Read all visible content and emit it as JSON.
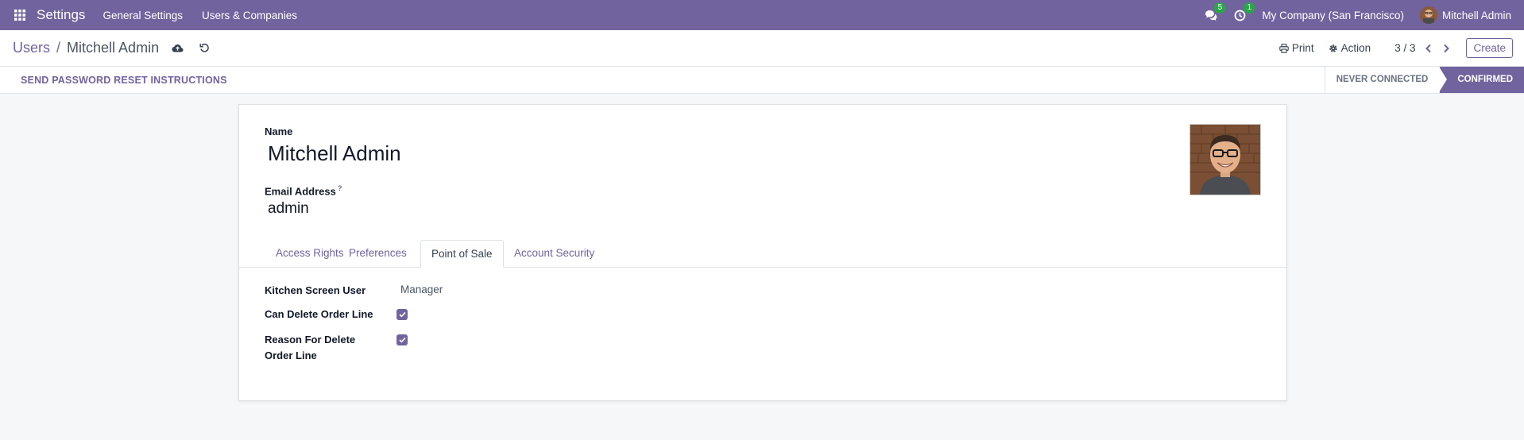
{
  "navbar": {
    "app_title": "Settings",
    "menu": [
      "General Settings",
      "Users & Companies"
    ],
    "messages_count": "5",
    "activities_count": "1",
    "company": "My Company (San Francisco)",
    "user": "Mitchell Admin",
    "bg_color": "#71639e"
  },
  "control_panel": {
    "breadcrumb_parent": "Users",
    "breadcrumb_sep": "/",
    "breadcrumb_current": "Mitchell Admin",
    "print_label": "Print",
    "action_label": "Action",
    "pager": "3 / 3",
    "create_label": "Create"
  },
  "statusbar": {
    "reset_button": "SEND PASSWORD RESET INSTRUCTIONS",
    "stages": [
      "NEVER CONNECTED",
      "CONFIRMED"
    ],
    "active_stage": "CONFIRMED"
  },
  "form": {
    "name_label": "Name",
    "name_value": "Mitchell Admin",
    "email_label": "Email Address",
    "email_help": "?",
    "email_value": "admin",
    "tabs": [
      "Access Rights",
      "Preferences",
      "Point of Sale",
      "Account Security"
    ],
    "active_tab": "Point of Sale",
    "fields": [
      {
        "label": "Kitchen Screen User",
        "value": "Manager"
      },
      {
        "label": "Can Delete Order Line",
        "checked": true
      },
      {
        "label": "Reason For Delete Order Line",
        "checked": true
      }
    ]
  }
}
